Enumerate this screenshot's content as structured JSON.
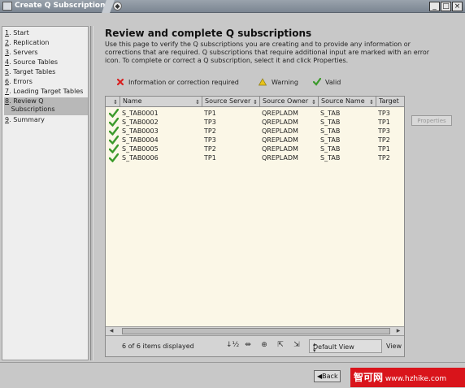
{
  "window": {
    "title": "Create Q Subscriptions"
  },
  "nav": {
    "items": [
      {
        "num": "1",
        "label": "Start"
      },
      {
        "num": "2",
        "label": "Replication"
      },
      {
        "num": "3",
        "label": "Servers"
      },
      {
        "num": "4",
        "label": "Source Tables"
      },
      {
        "num": "5",
        "label": "Target Tables"
      },
      {
        "num": "6",
        "label": "Errors"
      },
      {
        "num": "7",
        "label": "Loading Target Tables"
      },
      {
        "num": "8",
        "label": "Review Q",
        "label2": "Subscriptions"
      },
      {
        "num": "9",
        "label": "Summary"
      }
    ],
    "selected_index": 7
  },
  "main": {
    "heading": "Review and complete Q subscriptions",
    "description": "Use this page to verify the Q subscriptions you are creating and to provide any information or corrections that are required. Q subscriptions that require additional input are marked with an error icon. To complete or correct a Q subscription, select it and click Properties.",
    "legend": {
      "error_label": "Information or correction required",
      "warning_label": "Warning",
      "valid_label": "Valid"
    },
    "table": {
      "columns": [
        "Name",
        "Source Server",
        "Source Owner",
        "Source Name",
        "Target"
      ],
      "rows": [
        [
          "S_TAB0001",
          "TP1",
          "QREPLADM",
          "S_TAB",
          "TP3"
        ],
        [
          "S_TAB0002",
          "TP3",
          "QREPLADM",
          "S_TAB",
          "TP1"
        ],
        [
          "S_TAB0003",
          "TP2",
          "QREPLADM",
          "S_TAB",
          "TP3"
        ],
        [
          "S_TAB0004",
          "TP3",
          "QREPLADM",
          "S_TAB",
          "TP2"
        ],
        [
          "S_TAB0005",
          "TP2",
          "QREPLADM",
          "S_TAB",
          "TP1"
        ],
        [
          "S_TAB0006",
          "TP1",
          "QREPLADM",
          "S_TAB",
          "TP2"
        ]
      ],
      "status_text": "6 of 6 items displayed",
      "view_select": "Default View",
      "view_button": "View"
    },
    "properties_button": "Properties"
  },
  "bottom": {
    "back_label": "Back",
    "watermark_cn": "智可网",
    "watermark_url": "www.hzhike.com"
  },
  "colors": {
    "titlebar": "#8a939d",
    "table_bg": "#fbf7e7",
    "valid_check": "#3b9a2b",
    "error_x": "#d92020",
    "warning": "#e8c21a"
  }
}
